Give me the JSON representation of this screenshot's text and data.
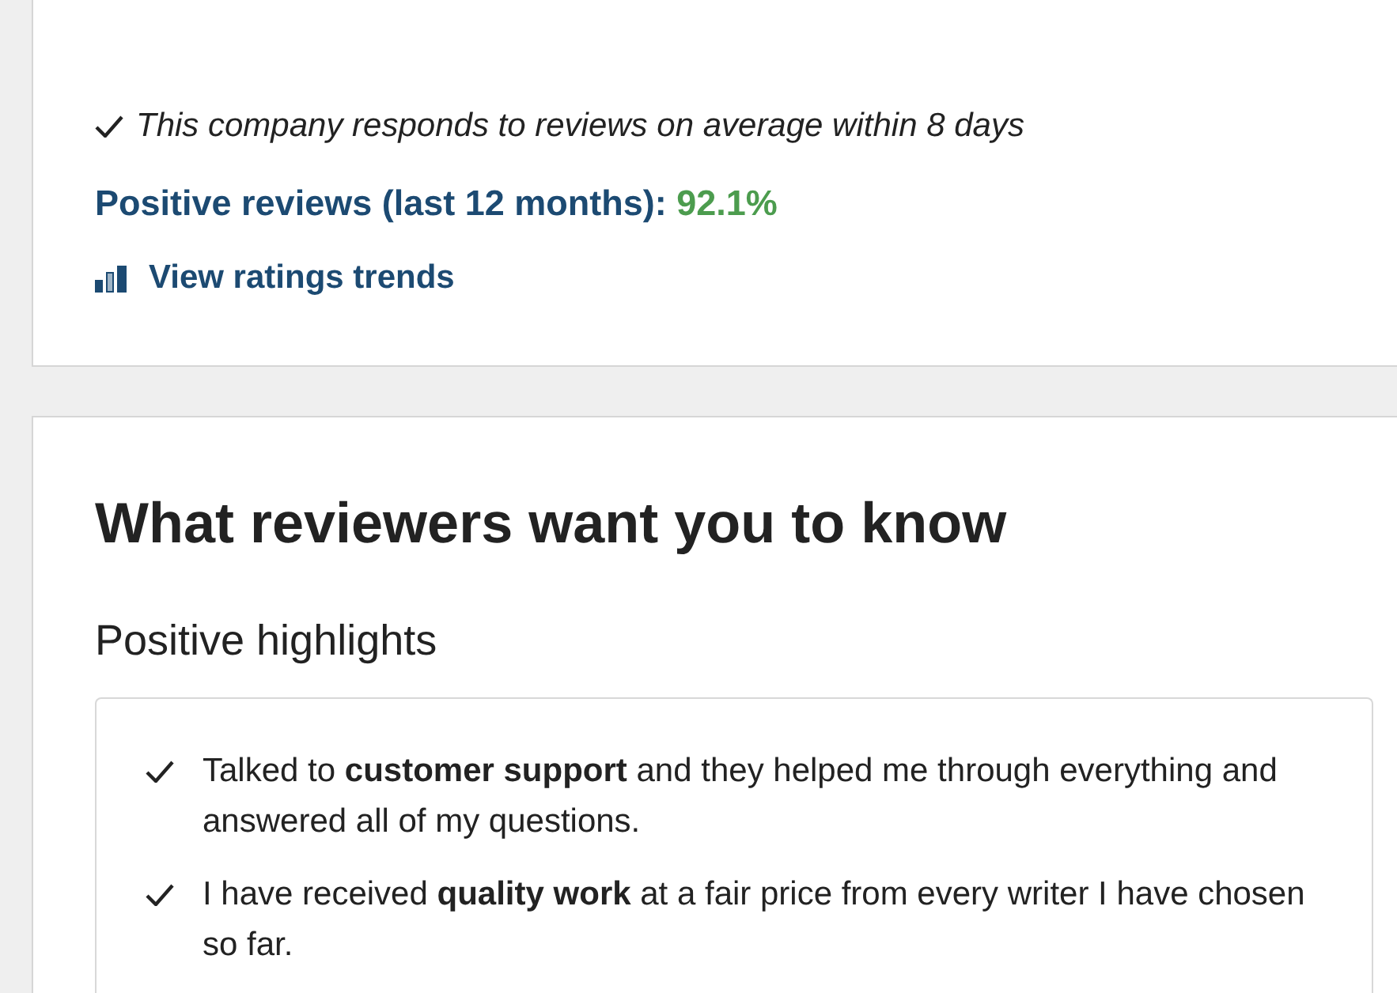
{
  "summary": {
    "response_note": "This company responds to reviews on average within 8 days",
    "positive_reviews": {
      "label": "Positive reviews (last 12 months):",
      "value": "92.1%"
    },
    "trends_link": "View ratings trends"
  },
  "highlights": {
    "title": "What reviewers want you to know",
    "subtitle": "Positive highlights",
    "items": [
      "Talked to **customer support** and they helped me through everything and answered all of my questions.",
      "I have received **quality work** at a fair price from every writer I have chosen so far."
    ]
  }
}
